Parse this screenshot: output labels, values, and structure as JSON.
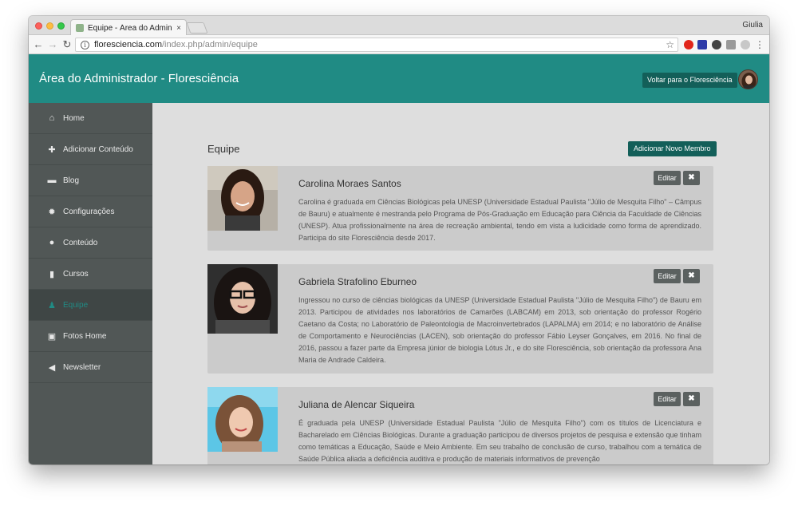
{
  "browser": {
    "tab_title": "Equipe - Área do Administrador",
    "tab_close": "×",
    "profile_name": "Giulia",
    "url_host": "floresciencia.com",
    "url_path": "/index.php/admin/equipe",
    "info_icon": "i",
    "star_icon": "☆"
  },
  "header": {
    "title": "Área do Administrador - Floresciência",
    "back_button": "Voltar para o Floresciência"
  },
  "sidebar": {
    "items": [
      {
        "label": "Home",
        "icon": "home-icon",
        "glyph": "⌂"
      },
      {
        "label": "Adicionar Conteúdo",
        "icon": "plus-icon",
        "glyph": "✚"
      },
      {
        "label": "Blog",
        "icon": "comment-icon",
        "glyph": "▬"
      },
      {
        "label": "Configurações",
        "icon": "gear-icon",
        "glyph": "✹"
      },
      {
        "label": "Conteúdo",
        "icon": "globe-icon",
        "glyph": "●"
      },
      {
        "label": "Cursos",
        "icon": "book-icon",
        "glyph": "▮"
      },
      {
        "label": "Equipe",
        "icon": "user-icon",
        "glyph": "♟"
      },
      {
        "label": "Fotos Home",
        "icon": "image-icon",
        "glyph": "▣"
      },
      {
        "label": "Newsletter",
        "icon": "bullhorn-icon",
        "glyph": "◀"
      }
    ],
    "active_item": "Equipe"
  },
  "main": {
    "section_title": "Equipe",
    "add_button": "Adicionar Novo Membro",
    "edit_label": "Editar",
    "delete_label": "✖",
    "members": [
      {
        "name": "Carolina Moraes Santos",
        "bio": "Carolina é graduada em Ciências Biológicas pela UNESP (Universidade Estadual Paulista \"Júlio de Mesquita Filho\" – Câmpus de Bauru) e atualmente é mestranda pelo Programa de Pós-Graduação em Educação para Ciência da Faculdade de Ciências (UNESP). Atua profissionalmente na área de recreação ambiental, tendo em vista a ludicidade como forma de aprendizado. Participa do site Floresciência desde 2017."
      },
      {
        "name": "Gabriela Strafolino Eburneo",
        "bio": "Ingressou no curso de ciências biológicas da UNESP (Universidade Estadual Paulista \"Júlio de Mesquita Filho\") de Bauru em 2013. Participou de atividades nos laboratórios de Camarões (LABCAM) em 2013, sob orientação do professor Rogério Caetano da Costa; no Laboratório de Paleontologia de Macroinvertebrados (LAPALMA) em 2014; e no laboratório de Análise de Comportamento e Neurociências (LACEN), sob orientação do professor Fábio Leyser Gonçalves, em 2016. No final de 2016, passou a fazer parte da Empresa júnior de biologia Lótus Jr., e do site Floresciência, sob orientação da professora Ana Maria de Andrade Caldeira."
      },
      {
        "name": "Juliana de Alencar Siqueira",
        "bio": "É graduada pela UNESP (Universidade Estadual Paulista \"Júlio de Mesquita Filho\") com os títulos de Licenciatura e Bacharelado em Ciências Biológicas. Durante a graduação participou de diversos projetos de pesquisa e extensão que tinham como temáticas a Educação, Saúde e Meio Ambiente. Em seu trabalho de conclusão de curso, trabalhou com a temática de Saúde Pública aliada a deficiência auditiva e produção de materiais informativos de prevenção"
      }
    ]
  },
  "colors": {
    "accent": "#208b84",
    "button_dark": "#135f59",
    "sidebar": "#515756",
    "card": "#cbcbcb"
  }
}
